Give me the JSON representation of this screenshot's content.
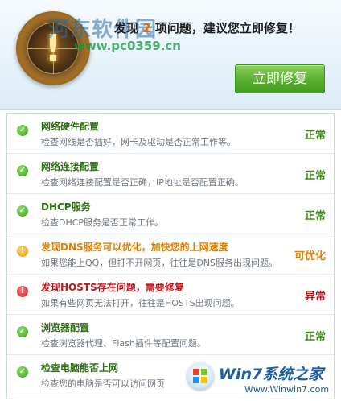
{
  "header": {
    "watermark_title": "河东软件园",
    "watermark_url": "www.pc0359.cn",
    "headline_prefix": "发现",
    "problem_count": "2",
    "headline_suffix": "项问题，建议您立即修复！",
    "fix_button_label": "立即修复",
    "accent_color": "#59ad2f"
  },
  "checks": [
    {
      "title": "网络硬件配置",
      "description": "检查网线是否插好，网卡及驱动是否正常工作等。",
      "status": "正常",
      "state": "ok",
      "icon": "check-icon"
    },
    {
      "title": "网络连接配置",
      "description": "检查网络连接配置是否正确，IP地址是否配置正确。",
      "status": "正常",
      "state": "ok",
      "icon": "check-icon"
    },
    {
      "title": "DHCP服务",
      "description": "检查DHCP服务是否正常工作。",
      "status": "正常",
      "state": "ok",
      "icon": "check-icon"
    },
    {
      "title": "发现DNS服务可以优化，加快您的上网速度",
      "description": "如果您能上QQ，但打不开网页，往往是DNS服务出现问题。",
      "status": "可优化",
      "state": "warn",
      "icon": "warning-icon"
    },
    {
      "title": "发现HOSTS存在问题，需要修复",
      "description": "如果有些网页无法打开，往往是HOSTS出现问题。",
      "status": "异常",
      "state": "err",
      "icon": "error-icon"
    },
    {
      "title": "浏览器配置",
      "description": "检查浏览器代理、Flash插件等配置问题。",
      "status": "正常",
      "state": "ok",
      "icon": "check-icon"
    },
    {
      "title": "检查电脑能否上网",
      "description": "检查您的电脑是否可以访问网页",
      "status": "",
      "state": "ok",
      "icon": "check-icon"
    }
  ],
  "corner_logo": {
    "text": "Win7系统之家",
    "url": "Www.Winwin7.com"
  }
}
